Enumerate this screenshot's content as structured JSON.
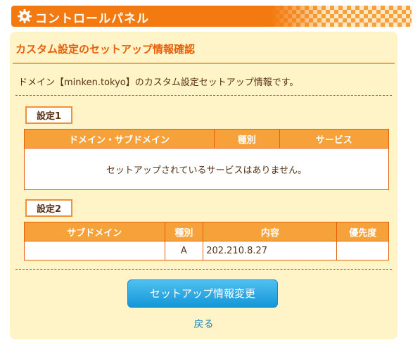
{
  "header": {
    "title": "コントロールパネル",
    "icon": "gear-icon",
    "color": "#f37a10"
  },
  "panel": {
    "title": "カスタム設定のセットアップ情報確認",
    "description": "ドメイン【minken.tokyo】のカスタム設定セットアップ情報です。"
  },
  "setting1": {
    "label": "設定1",
    "headers": [
      "ドメイン・サブドメイン",
      "種別",
      "サービス"
    ],
    "empty_message": "セットアップされているサービスはありません。"
  },
  "setting2": {
    "label": "設定2",
    "headers": [
      "サブドメイン",
      "種別",
      "内容",
      "優先度"
    ],
    "rows": [
      {
        "subdomain": "",
        "type": "A",
        "content": "202.210.8.27",
        "priority": ""
      }
    ]
  },
  "actions": {
    "change_label": "セットアップ情報変更",
    "back_label": "戻る",
    "button_color": "#1596d8"
  }
}
